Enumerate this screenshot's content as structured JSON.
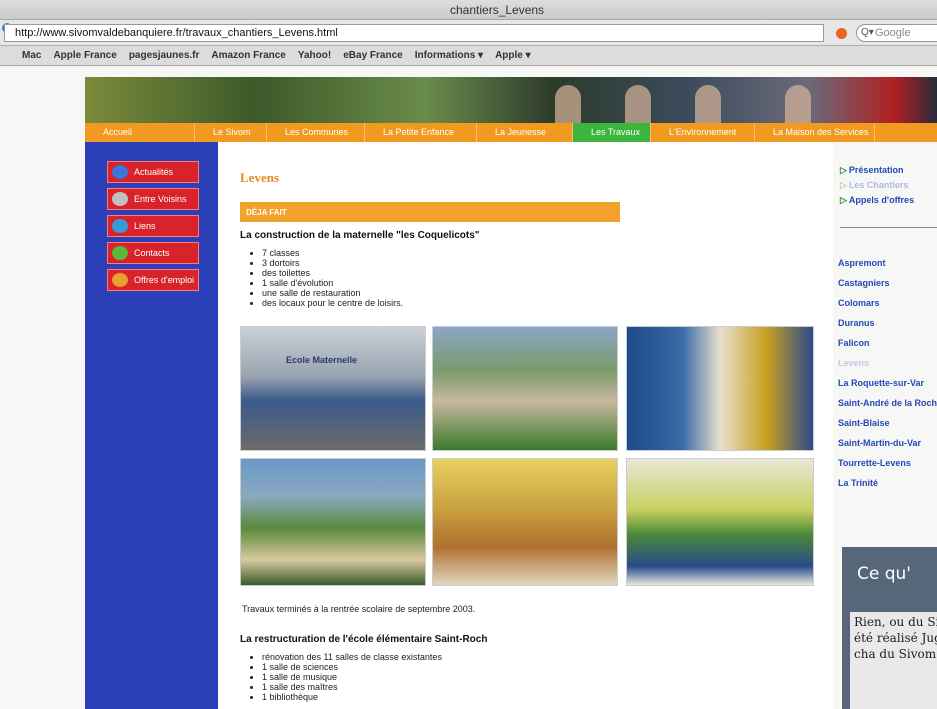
{
  "window": {
    "title": "chantiers_Levens"
  },
  "browser": {
    "url": "http://www.sivomvaldebanquiere.fr/travaux_chantiers_Levens.html",
    "search_placeholder": "Google",
    "bookmarks": [
      "Mac",
      "Apple France",
      "pagesjaunes.fr",
      "Amazon France",
      "Yahoo!",
      "eBay France",
      "Informations ▾",
      "Apple ▾"
    ]
  },
  "nav": {
    "items": [
      "Accueil",
      "Le Sivom",
      "Les Communes",
      "La Petite Enfance",
      "La Jeunesse",
      "Les Travaux",
      "L'Environnement",
      "La Maison des Services"
    ],
    "active_index": 5
  },
  "left_menu": [
    {
      "label": "Actualités",
      "icon": "news-icon",
      "color": "#3a78d8"
    },
    {
      "label": "Entre Voisins",
      "icon": "handshake-icon",
      "color": "#c0c0c0"
    },
    {
      "label": "Liens",
      "icon": "globe-icon",
      "color": "#3a9ad8"
    },
    {
      "label": "Contacts",
      "icon": "phone-icon",
      "color": "#5ab83a"
    },
    {
      "label": "Offres d'emploi",
      "icon": "people-icon",
      "color": "#e8a030"
    }
  ],
  "content": {
    "title": "Levens",
    "section": "DÉJA FAIT",
    "project1_title": "La construction de la maternelle \"les Coquelicots\"",
    "project1_items": [
      "7 classes",
      "3 dortoirs",
      "des toilettes",
      "1 salle d'évolution",
      "une salle de restauration",
      "des locaux pour le centre de loisirs."
    ],
    "photo1_sign": "Ecole Maternelle",
    "caption": "Travaux terminés à la rentrée scolaire de septembre 2003.",
    "project2_title": "La restructuration de l'école élémentaire Saint-Roch",
    "project2_items": [
      "rénovation des 11 salles de classe existantes",
      "1 salle de sciences",
      "1 salle de musique",
      "1 salle des maîtres",
      "1 bibliothèque"
    ]
  },
  "right_links": [
    "Présentation",
    "Les Chantiers",
    "Appels d'offres"
  ],
  "towns": [
    "Aspremont",
    "Castagniers",
    "Colomars",
    "Duranus",
    "Falicon",
    "Levens",
    "La Roquette-sur-Var",
    "Saint-André de la Roche",
    "Saint-Blaise",
    "Saint-Martin-du-Var",
    "Tourrette-Levens",
    "La Trinité"
  ],
  "overlay": {
    "heading": "Ce qu'",
    "text": "Rien, ou du Sivom été réalisé Juge, cha du Sivom"
  }
}
